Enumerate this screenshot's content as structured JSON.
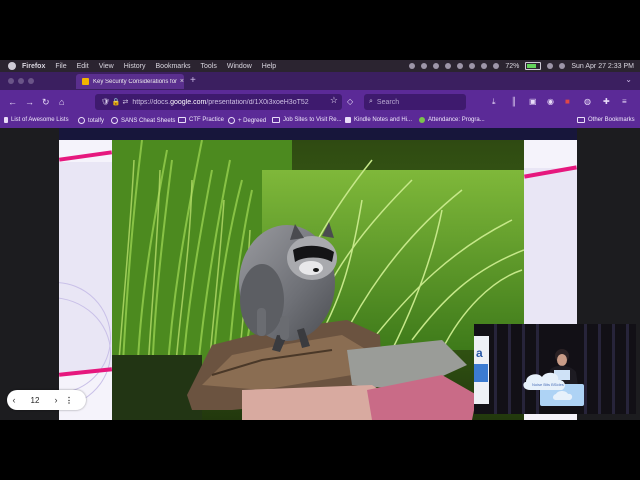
{
  "menubar": {
    "app_name": "Firefox",
    "menus": [
      "File",
      "Edit",
      "View",
      "History",
      "Bookmarks",
      "Tools",
      "Window",
      "Help"
    ],
    "battery_percent": "72%",
    "datetime": "Sun Apr 27  2:33 PM"
  },
  "tab": {
    "title": "Key Security Considerations for",
    "close": "×"
  },
  "tabstrip": {
    "new_tab": "+",
    "tab_menu": "⌄"
  },
  "nav": {
    "back": "←",
    "forward": "→",
    "reload": "↻",
    "home": "⌂",
    "url_prefix": "https://docs.",
    "url_domain": "google.com",
    "url_path": "/presentation/d/1X0i3xoeH3oT52",
    "bookmark_star": "☆",
    "search_placeholder": "Search"
  },
  "bookmarks": {
    "items": [
      "List of Awesome Lists",
      "totalfy",
      "SANS Cheat Sheets",
      "CTF Practice",
      "+ Degreed",
      "Job Sites to Visit Re...",
      "Kindle Notes and Hi...",
      "Attendance: Progra..."
    ],
    "other": "Other Bookmarks"
  },
  "slide": {
    "photo_subject": "raccoon-on-rock",
    "accent_color": "#e6187e",
    "dark_color": "#17163b"
  },
  "webcam": {
    "sign_text": "Noise Bits BSides"
  },
  "pager": {
    "prev": "‹",
    "page": "12",
    "next": "›",
    "more": "⋮"
  }
}
